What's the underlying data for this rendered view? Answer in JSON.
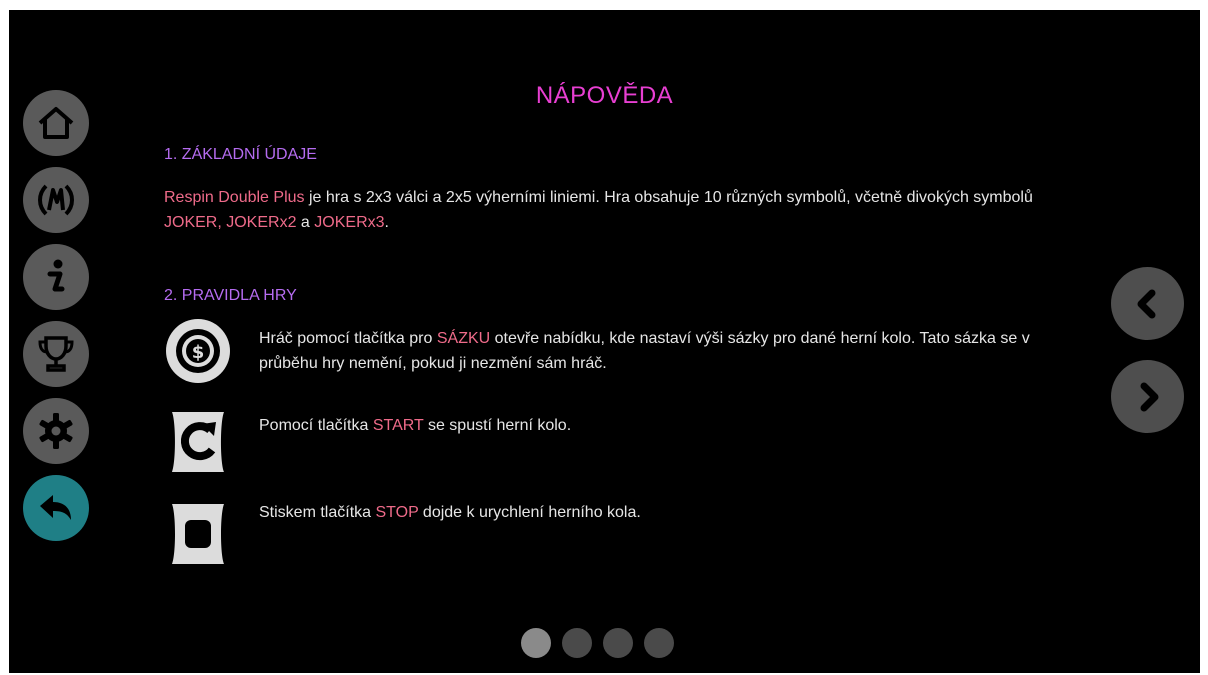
{
  "page": {
    "title": "NÁPOVĚDA"
  },
  "sidebar": {
    "items": [
      {
        "name": "home",
        "icon": "home-icon"
      },
      {
        "name": "paytable",
        "icon": "paytable-icon"
      },
      {
        "name": "info",
        "icon": "info-icon"
      },
      {
        "name": "trophy",
        "icon": "trophy-icon"
      },
      {
        "name": "settings",
        "icon": "gear-icon"
      },
      {
        "name": "back",
        "icon": "back-arrow-icon"
      }
    ]
  },
  "section1": {
    "heading": "1. ZÁKLADNÍ ÚDAJE",
    "game_name": "Respin Double Plus",
    "text_a": " je hra s 2x3 válci a 2x5 výherními liniemi. Hra obsahuje 10 různých symbolů, včetně divokých symbolů ",
    "wild1": "JOKER, JOKERx2",
    "text_b": " a ",
    "wild2": "JOKERx3",
    "text_c": "."
  },
  "section2": {
    "heading": "2. PRAVIDLA HRY",
    "rules": [
      {
        "icon": "bet-coin-icon",
        "pre": "Hráč pomocí tlačítka pro ",
        "hl": "SÁZKU",
        "post": " otevře nabídku, kde nastaví výši sázky pro dané herní kolo. Tato sázka se v průběhu hry nemění, pokud ji nezmění sám hráč."
      },
      {
        "icon": "start-spin-icon",
        "pre": "Pomocí tlačítka ",
        "hl": "START",
        "post": " se spustí herní kolo."
      },
      {
        "icon": "stop-icon",
        "pre": "Stiskem tlačítka ",
        "hl": "STOP",
        "post": " dojde k urychlení herního kola."
      }
    ]
  },
  "pager": {
    "count": 4,
    "active_index": 0
  },
  "colors": {
    "title": "#e83fd2",
    "section_heading": "#b56cf0",
    "highlight": "#ef6b8a",
    "body_text": "#e6e6e6",
    "sidebar_button": "#5a5a5a",
    "back_button": "#1f7f86",
    "background": "#000000"
  }
}
